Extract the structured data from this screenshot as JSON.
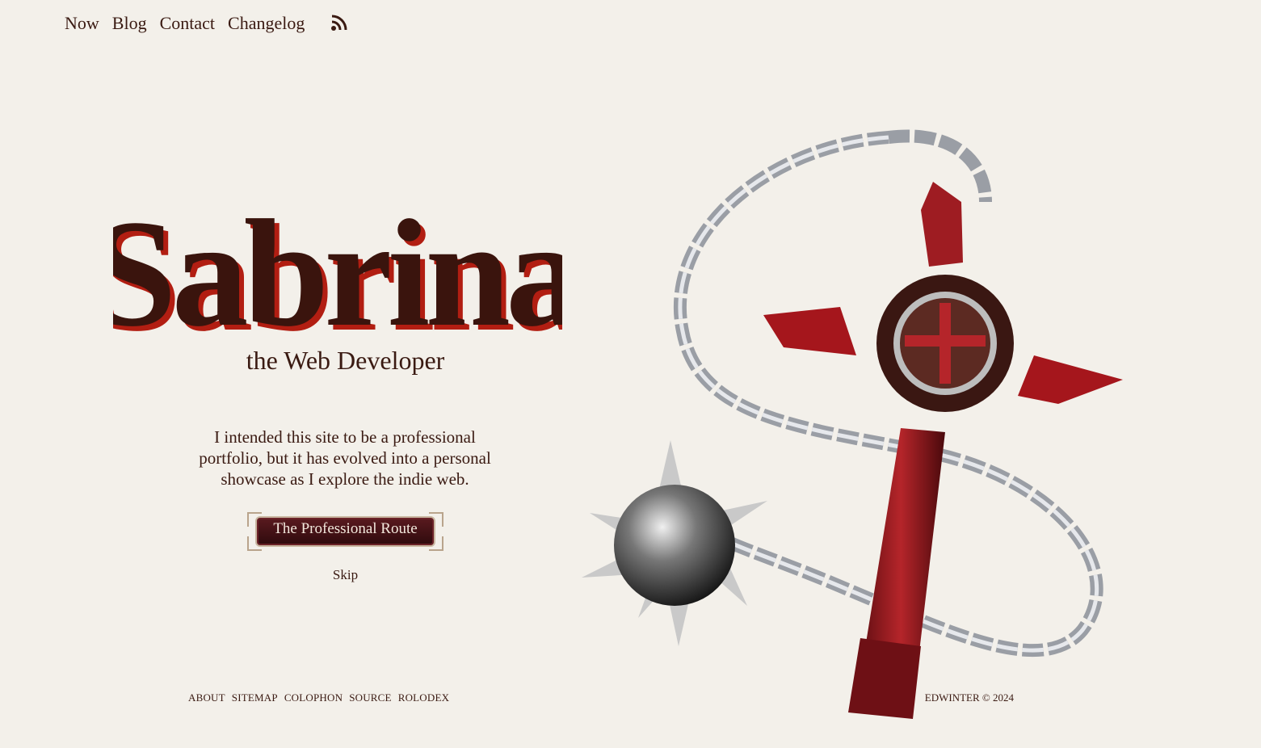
{
  "nav": {
    "links": [
      "Now",
      "Blog",
      "Contact",
      "Changelog"
    ],
    "rss_icon": "rss-icon"
  },
  "hero": {
    "title": "Sabrina",
    "subtitle": "the Web Developer",
    "intro": "I intended this site to be a professional portfolio, but it has evolved into a personal showcase as I explore the indie web.",
    "cta_label": "The Professional Route",
    "skip_label": "Skip"
  },
  "footer": {
    "links": [
      "ABOUT",
      "SITEMAP",
      "COLOPHON",
      "SOURCE",
      "ROLODEX"
    ],
    "copyright": "EDWINTER © 2024"
  },
  "colors": {
    "background": "#f3f0ea",
    "text": "#3a1a12",
    "accent": "#b21e12",
    "button": "#4a1216"
  },
  "artwork": "flail-weapon-illustration"
}
